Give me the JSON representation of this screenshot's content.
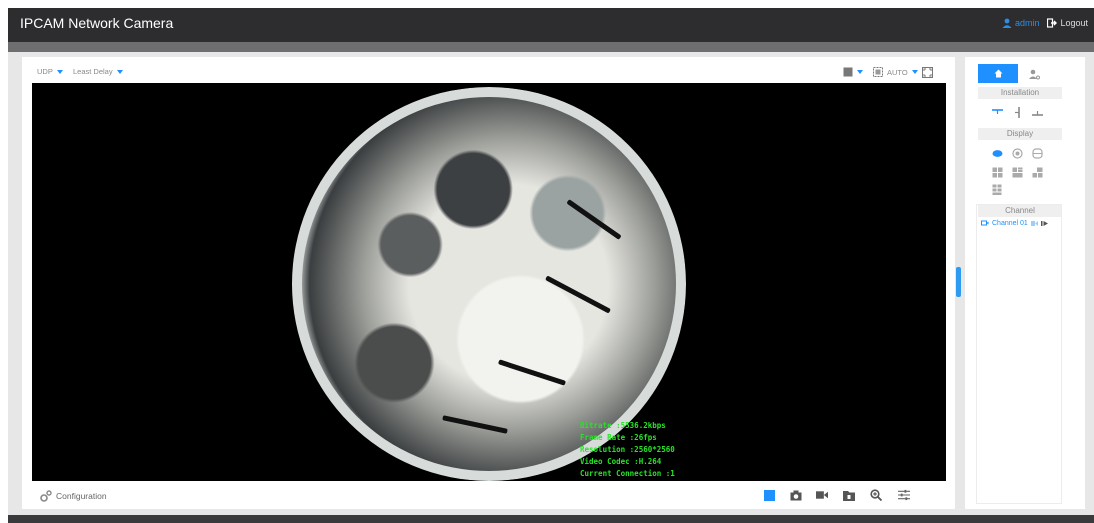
{
  "header": {
    "title": "IPCAM Network Camera",
    "user": "admin",
    "logout": "Logout"
  },
  "toolbar": {
    "protocol": "UDP",
    "delay": "Least Delay",
    "scale": "AUTO"
  },
  "osd": {
    "bitrate": "Bitrate :5536.2kbps",
    "frame_rate": "Frame Rate :26fps",
    "resolution": "Resolution :2560*2560",
    "video_codec": "Video Codec :H.264",
    "connection": "Current Connection :1"
  },
  "footer": {
    "configuration": "Configuration"
  },
  "sidebar": {
    "installation": "Installation",
    "display": "Display",
    "channel": "Channel",
    "channel_item": "Channel 01"
  },
  "colors": {
    "accent": "#1e90ff",
    "topbar": "#2d2d30",
    "osd_text": "#27e427"
  }
}
